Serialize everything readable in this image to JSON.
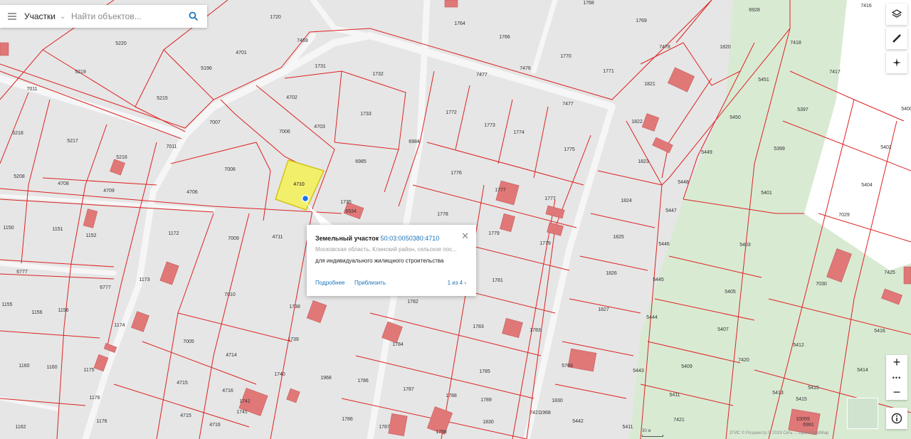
{
  "search": {
    "category": "Участки",
    "placeholder": "Найти объектов..."
  },
  "popup": {
    "title": "Земельный участок",
    "cadastral_number": "50:03:0050380:4710",
    "address": "Московская область, Клинский район, сельское пос...",
    "purpose": "для индивидуального жилищного строительства",
    "details_link": "Подробнее",
    "zoom_link": "Приблизить",
    "pager": "1 из 4",
    "close_label": "✕"
  },
  "controls": {
    "zoom_in": "+",
    "more": "•••",
    "zoom_out": "−"
  },
  "scale_label": "30 м",
  "attribution": "2ГИС © Рosреестр © 2019 Сеть ... OpenStreetMap",
  "selected_parcel": "4710",
  "parcel_labels": [
    "1720",
    "1768",
    "1769",
    "6928",
    "7416",
    "5220",
    "4701",
    "7469",
    "1764",
    "1766",
    "7418",
    "5219",
    "5196",
    "1731",
    "1732",
    "7477",
    "1770",
    "1771",
    "7478",
    "1820",
    "7011",
    "5215",
    "4702",
    "7476",
    "7417",
    "5218",
    "1733",
    "1772",
    "1773",
    "1821",
    "5451",
    "5397",
    "5400",
    "7007",
    "7006",
    "4703",
    "7477",
    "1774",
    "1775",
    "1822",
    "5450",
    "5217",
    "7011",
    "6984",
    "1823",
    "5449",
    "5399",
    "5402",
    "5216",
    "6985",
    "1776",
    "7008",
    "4706",
    "4710",
    "1777",
    "5448",
    "5401",
    "5404",
    "5208",
    "4708",
    "4709",
    "1735",
    "1777",
    "1824",
    "5447",
    "7029",
    "6934",
    "1778",
    "1150",
    "1151",
    "1152",
    "1172",
    "7009",
    "4711",
    "1779",
    "1825",
    "5446",
    "5403",
    "1779",
    "1826",
    "5445",
    "5405",
    "7030",
    "7425",
    "6777",
    "1173",
    "6777",
    "1781",
    "1827",
    "5444",
    "5407",
    "5416",
    "1155",
    "1156",
    "1156",
    "1174",
    "7010",
    "1738",
    "1782",
    "1783",
    "1783",
    "5412",
    "1160",
    "1160",
    "7005",
    "1739",
    "4714",
    "1784",
    "1785",
    "1968",
    "5769",
    "5409",
    "5414",
    "1175",
    "1176",
    "4715",
    "4716",
    "1740",
    "1741",
    "1741",
    "1786",
    "1787",
    "1788",
    "1789",
    "1830",
    "5443",
    "5411",
    "7420",
    "5413",
    "5415",
    "1162",
    "1176",
    "4715",
    "4716",
    "1786",
    "1787",
    "1788",
    "1830",
    "5442",
    "5411",
    "7421",
    "5415",
    "10059",
    "6991",
    "1968",
    "7421"
  ]
}
